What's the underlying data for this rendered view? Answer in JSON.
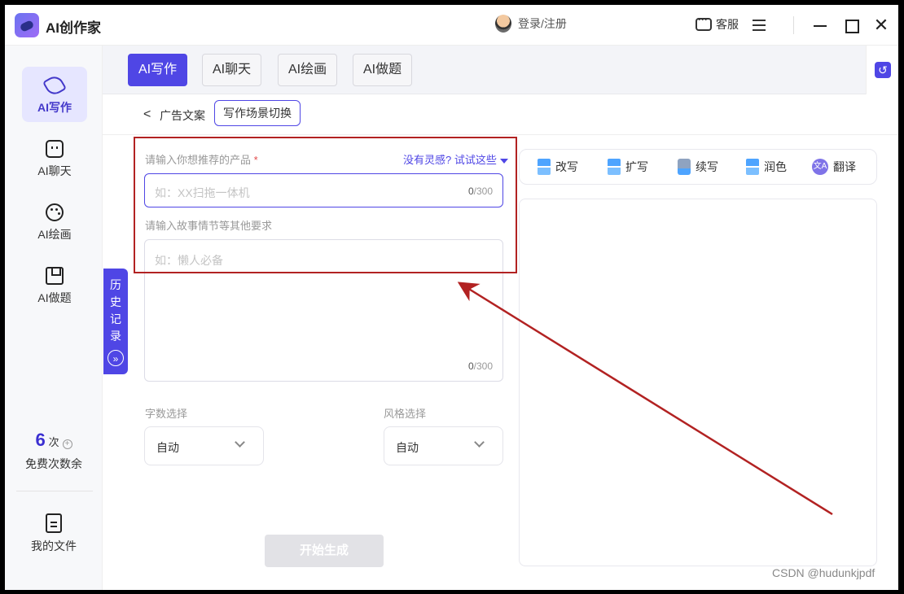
{
  "app": {
    "title": "AI创作家"
  },
  "header": {
    "login": "登录/注册",
    "service": "客服"
  },
  "sidebar": {
    "items": [
      {
        "label": "AI写作"
      },
      {
        "label": "AI聊天"
      },
      {
        "label": "AI绘画"
      },
      {
        "label": "AI做题"
      }
    ],
    "credits": {
      "count": "6",
      "unit": "次",
      "label": "免费次数余"
    },
    "files": "我的文件"
  },
  "history": {
    "chars": [
      "历",
      "史",
      "记",
      "录"
    ],
    "arrow": "»"
  },
  "tabs": [
    "AI写作",
    "AI聊天",
    "AI绘画",
    "AI做题"
  ],
  "breadcrumb": {
    "back": "<",
    "current": "广告文案",
    "switch": "写作场景切换"
  },
  "form": {
    "product_label": "请输入你想推荐的产品",
    "required_mark": "*",
    "inspire": "没有灵感? 试试这些",
    "product_placeholder": "如：XX扫拖一体机",
    "product_count": "0",
    "product_max": "/300",
    "story_label": "请输入故事情节等其他要求",
    "story_placeholder": "如：懒人必备",
    "story_count": "0",
    "story_max": "/300",
    "words_label": "字数选择",
    "words_value": "自动",
    "style_label": "风格选择",
    "style_value": "自动",
    "generate": "开始生成"
  },
  "tools": [
    {
      "label": "改写",
      "icon": "rewrite-icon"
    },
    {
      "label": "扩写",
      "icon": "expand-icon"
    },
    {
      "label": "续写",
      "icon": "continue-icon"
    },
    {
      "label": "润色",
      "icon": "polish-icon"
    },
    {
      "label": "翻译",
      "icon": "translate-icon"
    }
  ],
  "watermark": "CSDN @hudunkjpdf",
  "colors": {
    "accent": "#4f46e5",
    "annotation": "#b22222"
  }
}
